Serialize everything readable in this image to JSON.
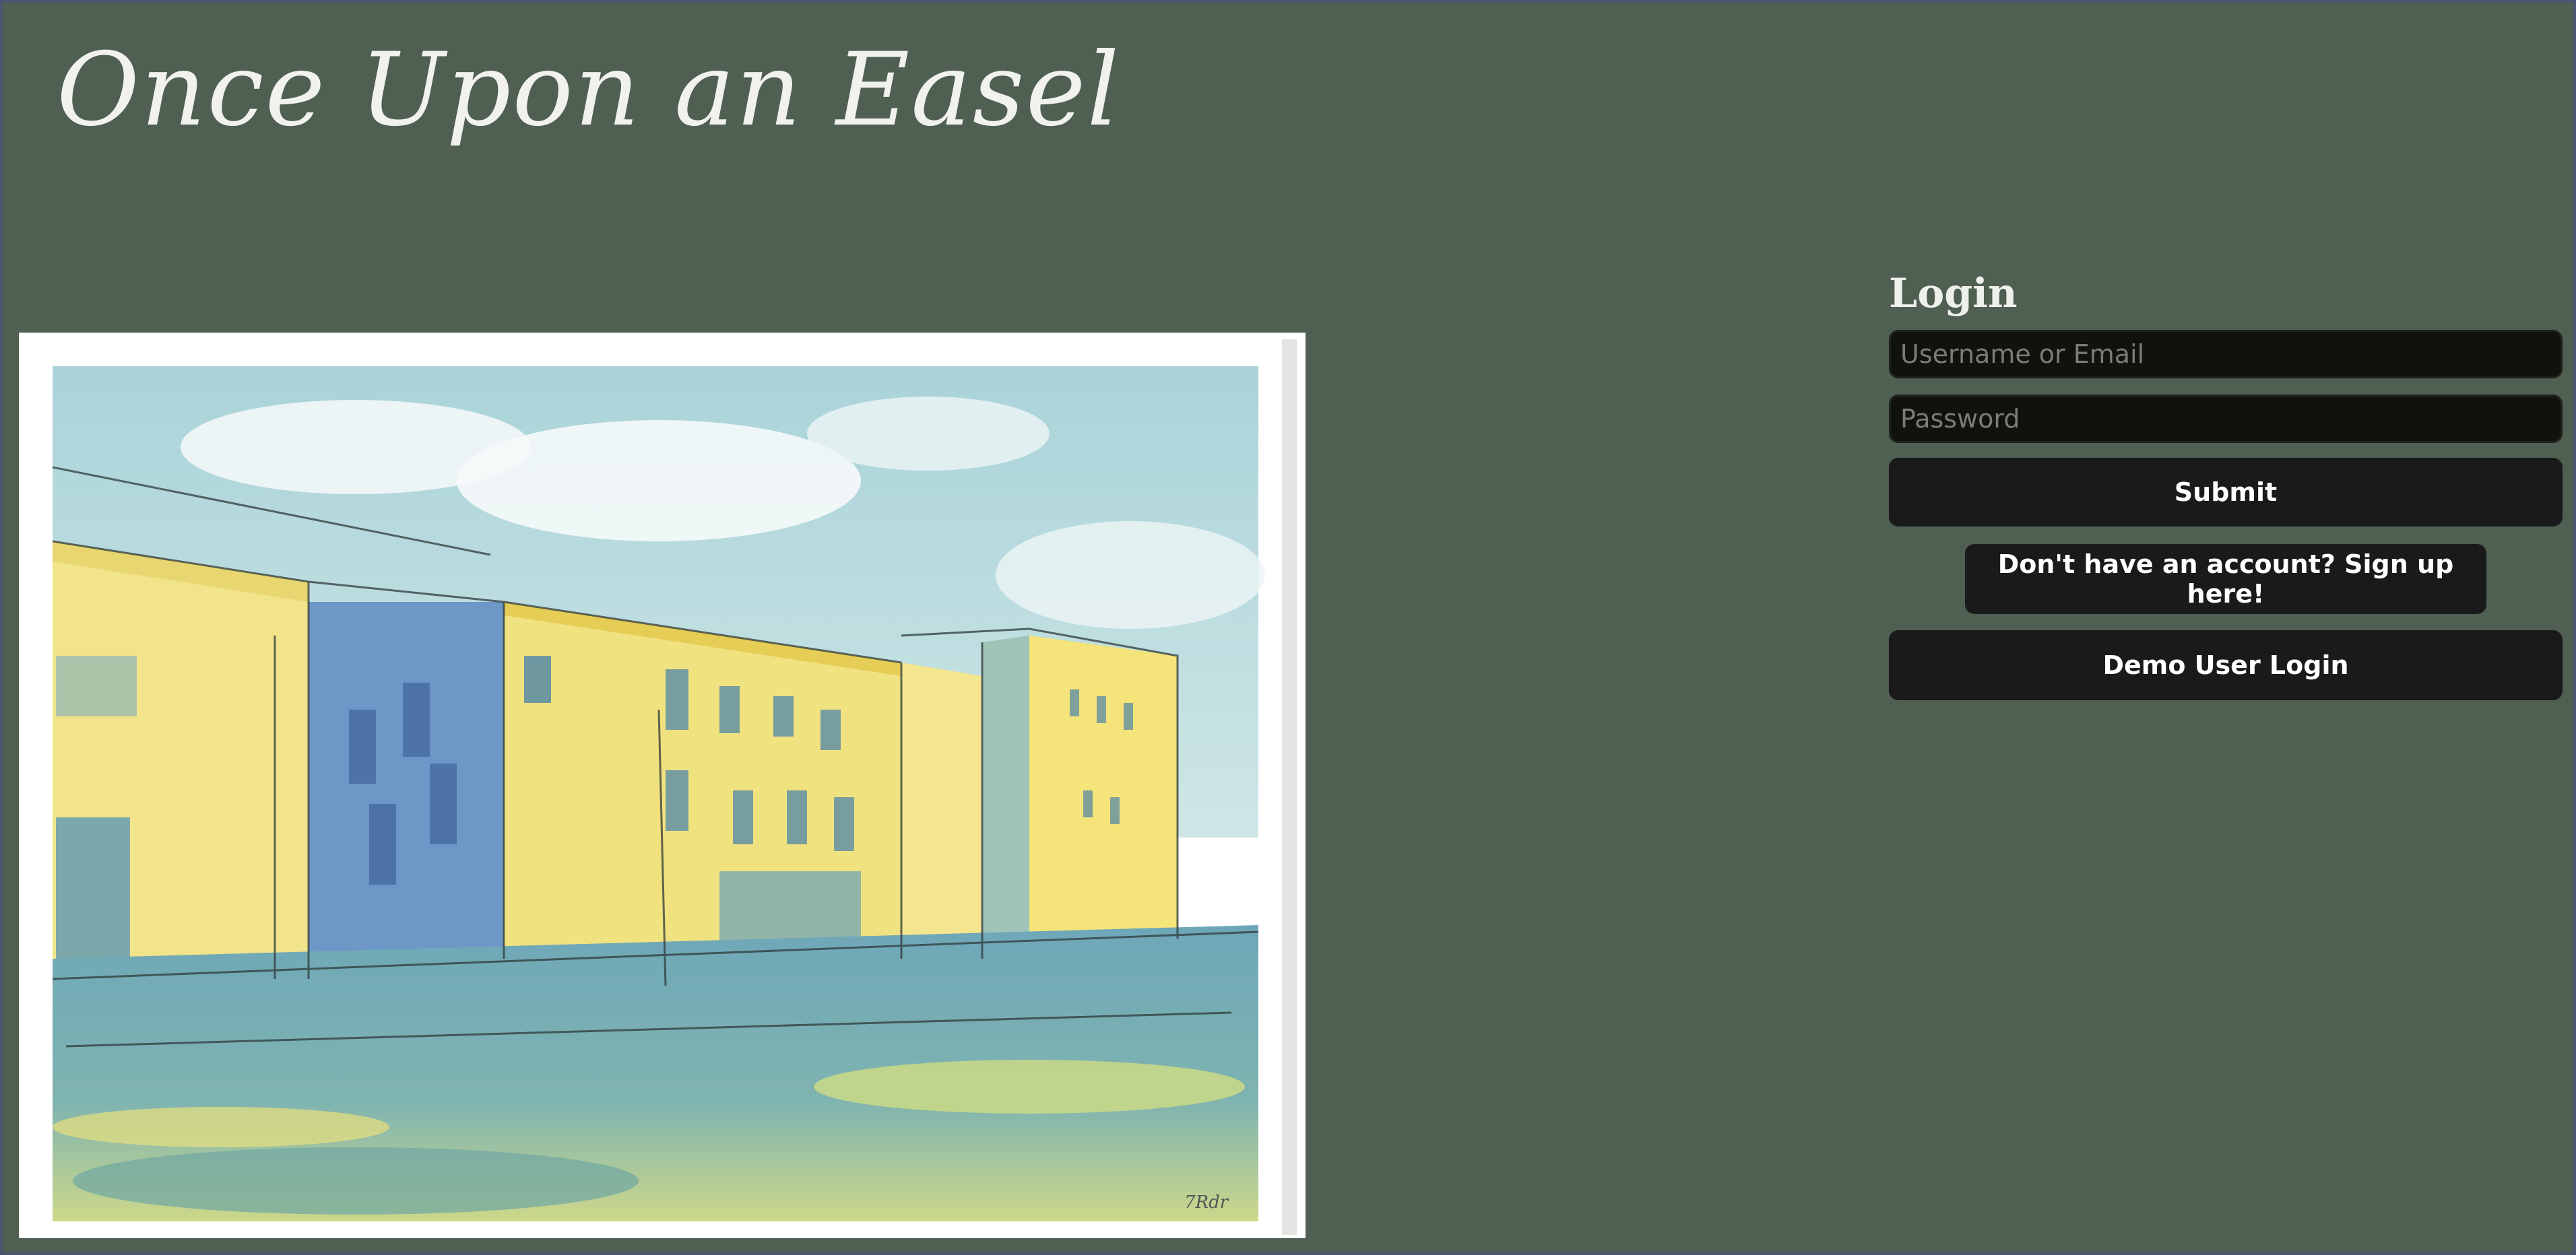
{
  "header": {
    "brand_name": "Once Upon an Easel"
  },
  "hero": {
    "image_description": "watercolor-street-painting"
  },
  "login": {
    "title": "Login",
    "username_placeholder": "Username or Email",
    "username_value": "",
    "password_placeholder": "Password",
    "password_value": "",
    "submit_label": "Submit",
    "signup_label": "Don't have an account? Sign up here!",
    "demo_label": "Demo User Login"
  },
  "colors": {
    "background": "#4f5f52",
    "input_bg": "#10130d",
    "button_bg": "#1a1a1a",
    "text_light": "#eef0ea"
  }
}
